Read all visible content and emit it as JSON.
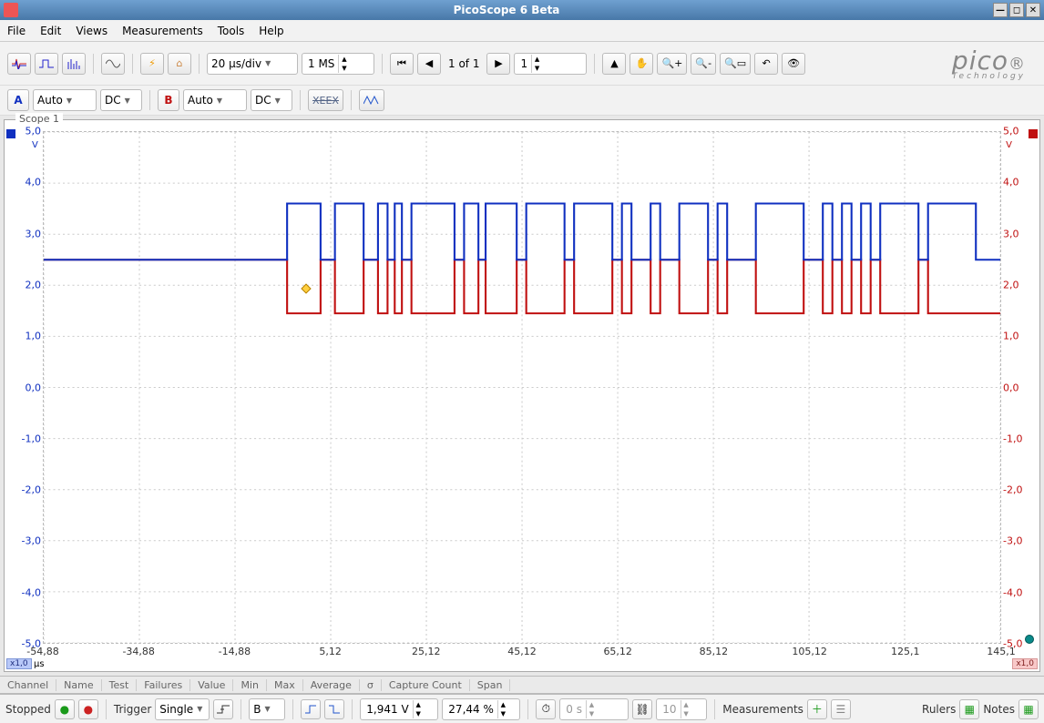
{
  "window": {
    "title": "PicoScope 6 Beta"
  },
  "menu": [
    "File",
    "Edit",
    "Views",
    "Measurements",
    "Tools",
    "Help"
  ],
  "toolbar1": {
    "timebase": "20 µs/div",
    "samples": "1 MS",
    "page": "1 of 1",
    "waveform": "1"
  },
  "channelA": {
    "letter": "A",
    "range": "Auto",
    "coupling": "DC"
  },
  "channelB": {
    "letter": "B",
    "range": "Auto",
    "coupling": "DC"
  },
  "scope": {
    "title": "Scope 1",
    "y_ticks": [
      "5,0",
      "4,0",
      "3,0",
      "2,0",
      "1,0",
      "0,0",
      "-1,0",
      "-2,0",
      "-3,0",
      "-4,0",
      "-5,0"
    ],
    "y_unit_a": "V",
    "y_unit_b": "V",
    "x_ticks": [
      "-54,88",
      "-34,88",
      "-14,88",
      "5,12",
      "25,12",
      "45,12",
      "65,12",
      "85,12",
      "105,12",
      "125,1",
      "145,1"
    ],
    "x_unit": "µs",
    "zoom_a": "x1,0",
    "zoom_b": "x1,0"
  },
  "table_cols": [
    "Channel",
    "Name",
    "Test",
    "Failures",
    "Value",
    "Min",
    "Max",
    "Average",
    "σ",
    "Capture Count",
    "Span"
  ],
  "status": {
    "state": "Stopped",
    "trigger_label": "Trigger",
    "trigger_mode": "Single",
    "trigger_source": "B",
    "trigger_level": "1,941 V",
    "trigger_pos": "27,44 %",
    "trigger_delay": "0 s",
    "trigger_count": "10",
    "meas_label": "Measurements",
    "rulers_label": "Rulers",
    "notes_label": "Notes"
  },
  "logo": {
    "brand": "pico",
    "sub": "Technology"
  },
  "chart_data": {
    "type": "line",
    "title": "Scope 1",
    "xlabel": "µs",
    "ylabel": "V",
    "xlim": [
      -54.88,
      145.1
    ],
    "ylim": [
      -5.0,
      5.0
    ],
    "x_ticks": [
      -54.88,
      -34.88,
      -14.88,
      5.12,
      25.12,
      45.12,
      65.12,
      85.12,
      105.12,
      125.1,
      145.1
    ],
    "y_ticks": [
      -5,
      -4,
      -3,
      -2,
      -1,
      0,
      1,
      2,
      3,
      4,
      5
    ],
    "series": [
      {
        "name": "Channel A",
        "color": "#1030c0",
        "idle_level": 2.5,
        "high_level": 3.6,
        "transitions": [
          [
            -54.88,
            2.5
          ],
          [
            -4,
            2.5
          ],
          [
            -4,
            3.6
          ],
          [
            3,
            3.6
          ],
          [
            3,
            2.5
          ],
          [
            6,
            2.5
          ],
          [
            6,
            3.6
          ],
          [
            12,
            3.6
          ],
          [
            12,
            2.5
          ],
          [
            15,
            2.5
          ],
          [
            15,
            3.6
          ],
          [
            17,
            3.6
          ],
          [
            17,
            2.5
          ],
          [
            18.5,
            2.5
          ],
          [
            18.5,
            3.6
          ],
          [
            20,
            3.6
          ],
          [
            20,
            2.5
          ],
          [
            22,
            2.5
          ],
          [
            22,
            3.6
          ],
          [
            31,
            3.6
          ],
          [
            31,
            2.5
          ],
          [
            33,
            2.5
          ],
          [
            33,
            3.6
          ],
          [
            36,
            3.6
          ],
          [
            36,
            2.5
          ],
          [
            37.5,
            2.5
          ],
          [
            37.5,
            3.6
          ],
          [
            44,
            3.6
          ],
          [
            44,
            2.5
          ],
          [
            46,
            2.5
          ],
          [
            46,
            3.6
          ],
          [
            54,
            3.6
          ],
          [
            54,
            2.5
          ],
          [
            56,
            2.5
          ],
          [
            56,
            3.6
          ],
          [
            64,
            3.6
          ],
          [
            64,
            2.5
          ],
          [
            66,
            2.5
          ],
          [
            66,
            3.6
          ],
          [
            68,
            3.6
          ],
          [
            68,
            2.5
          ],
          [
            72,
            2.5
          ],
          [
            72,
            3.6
          ],
          [
            74,
            3.6
          ],
          [
            74,
            2.5
          ],
          [
            78,
            2.5
          ],
          [
            78,
            3.6
          ],
          [
            84,
            3.6
          ],
          [
            84,
            2.5
          ],
          [
            86,
            2.5
          ],
          [
            86,
            3.6
          ],
          [
            88,
            3.6
          ],
          [
            88,
            2.5
          ],
          [
            94,
            2.5
          ],
          [
            94,
            3.6
          ],
          [
            104,
            3.6
          ],
          [
            104,
            2.5
          ],
          [
            108,
            2.5
          ],
          [
            108,
            3.6
          ],
          [
            110,
            3.6
          ],
          [
            110,
            2.5
          ],
          [
            112,
            2.5
          ],
          [
            112,
            3.6
          ],
          [
            114,
            3.6
          ],
          [
            114,
            2.5
          ],
          [
            116,
            2.5
          ],
          [
            116,
            3.6
          ],
          [
            118,
            3.6
          ],
          [
            118,
            2.5
          ],
          [
            120,
            2.5
          ],
          [
            120,
            3.6
          ],
          [
            128,
            3.6
          ],
          [
            128,
            2.5
          ],
          [
            130,
            2.5
          ],
          [
            130,
            3.6
          ],
          [
            140,
            3.6
          ],
          [
            140,
            2.5
          ],
          [
            145.1,
            2.5
          ]
        ]
      },
      {
        "name": "Channel B",
        "color": "#c01010",
        "idle_level": 2.5,
        "low_level": 1.45,
        "transitions": [
          [
            -54.88,
            2.5
          ],
          [
            -4,
            2.5
          ],
          [
            -4,
            1.45
          ],
          [
            3,
            1.45
          ],
          [
            3,
            2.5
          ],
          [
            6,
            2.5
          ],
          [
            6,
            1.45
          ],
          [
            12,
            1.45
          ],
          [
            12,
            2.5
          ],
          [
            15,
            2.5
          ],
          [
            15,
            1.45
          ],
          [
            17,
            1.45
          ],
          [
            17,
            2.5
          ],
          [
            18.5,
            2.5
          ],
          [
            18.5,
            1.45
          ],
          [
            20,
            1.45
          ],
          [
            20,
            2.5
          ],
          [
            22,
            2.5
          ],
          [
            22,
            1.45
          ],
          [
            31,
            1.45
          ],
          [
            31,
            2.5
          ],
          [
            33,
            2.5
          ],
          [
            33,
            1.45
          ],
          [
            36,
            1.45
          ],
          [
            36,
            2.5
          ],
          [
            37.5,
            2.5
          ],
          [
            37.5,
            1.45
          ],
          [
            44,
            1.45
          ],
          [
            44,
            2.5
          ],
          [
            46,
            2.5
          ],
          [
            46,
            1.45
          ],
          [
            54,
            1.45
          ],
          [
            54,
            2.5
          ],
          [
            56,
            2.5
          ],
          [
            56,
            1.45
          ],
          [
            64,
            1.45
          ],
          [
            64,
            2.5
          ],
          [
            66,
            2.5
          ],
          [
            66,
            1.45
          ],
          [
            68,
            1.45
          ],
          [
            68,
            2.5
          ],
          [
            72,
            2.5
          ],
          [
            72,
            1.45
          ],
          [
            74,
            1.45
          ],
          [
            74,
            2.5
          ],
          [
            78,
            2.5
          ],
          [
            78,
            1.45
          ],
          [
            84,
            1.45
          ],
          [
            84,
            2.5
          ],
          [
            86,
            2.5
          ],
          [
            86,
            1.45
          ],
          [
            88,
            1.45
          ],
          [
            88,
            2.5
          ],
          [
            94,
            2.5
          ],
          [
            94,
            1.45
          ],
          [
            104,
            1.45
          ],
          [
            104,
            2.5
          ],
          [
            108,
            2.5
          ],
          [
            108,
            1.45
          ],
          [
            110,
            1.45
          ],
          [
            110,
            2.5
          ],
          [
            112,
            2.5
          ],
          [
            112,
            1.45
          ],
          [
            114,
            1.45
          ],
          [
            114,
            2.5
          ],
          [
            116,
            2.5
          ],
          [
            116,
            1.45
          ],
          [
            118,
            1.45
          ],
          [
            118,
            2.5
          ],
          [
            120,
            2.5
          ],
          [
            120,
            1.45
          ],
          [
            128,
            1.45
          ],
          [
            128,
            2.5
          ],
          [
            130,
            2.5
          ],
          [
            130,
            1.45
          ],
          [
            145.1,
            1.45
          ]
        ]
      }
    ],
    "trigger_marker": {
      "x": 0,
      "y": 1.941
    }
  }
}
